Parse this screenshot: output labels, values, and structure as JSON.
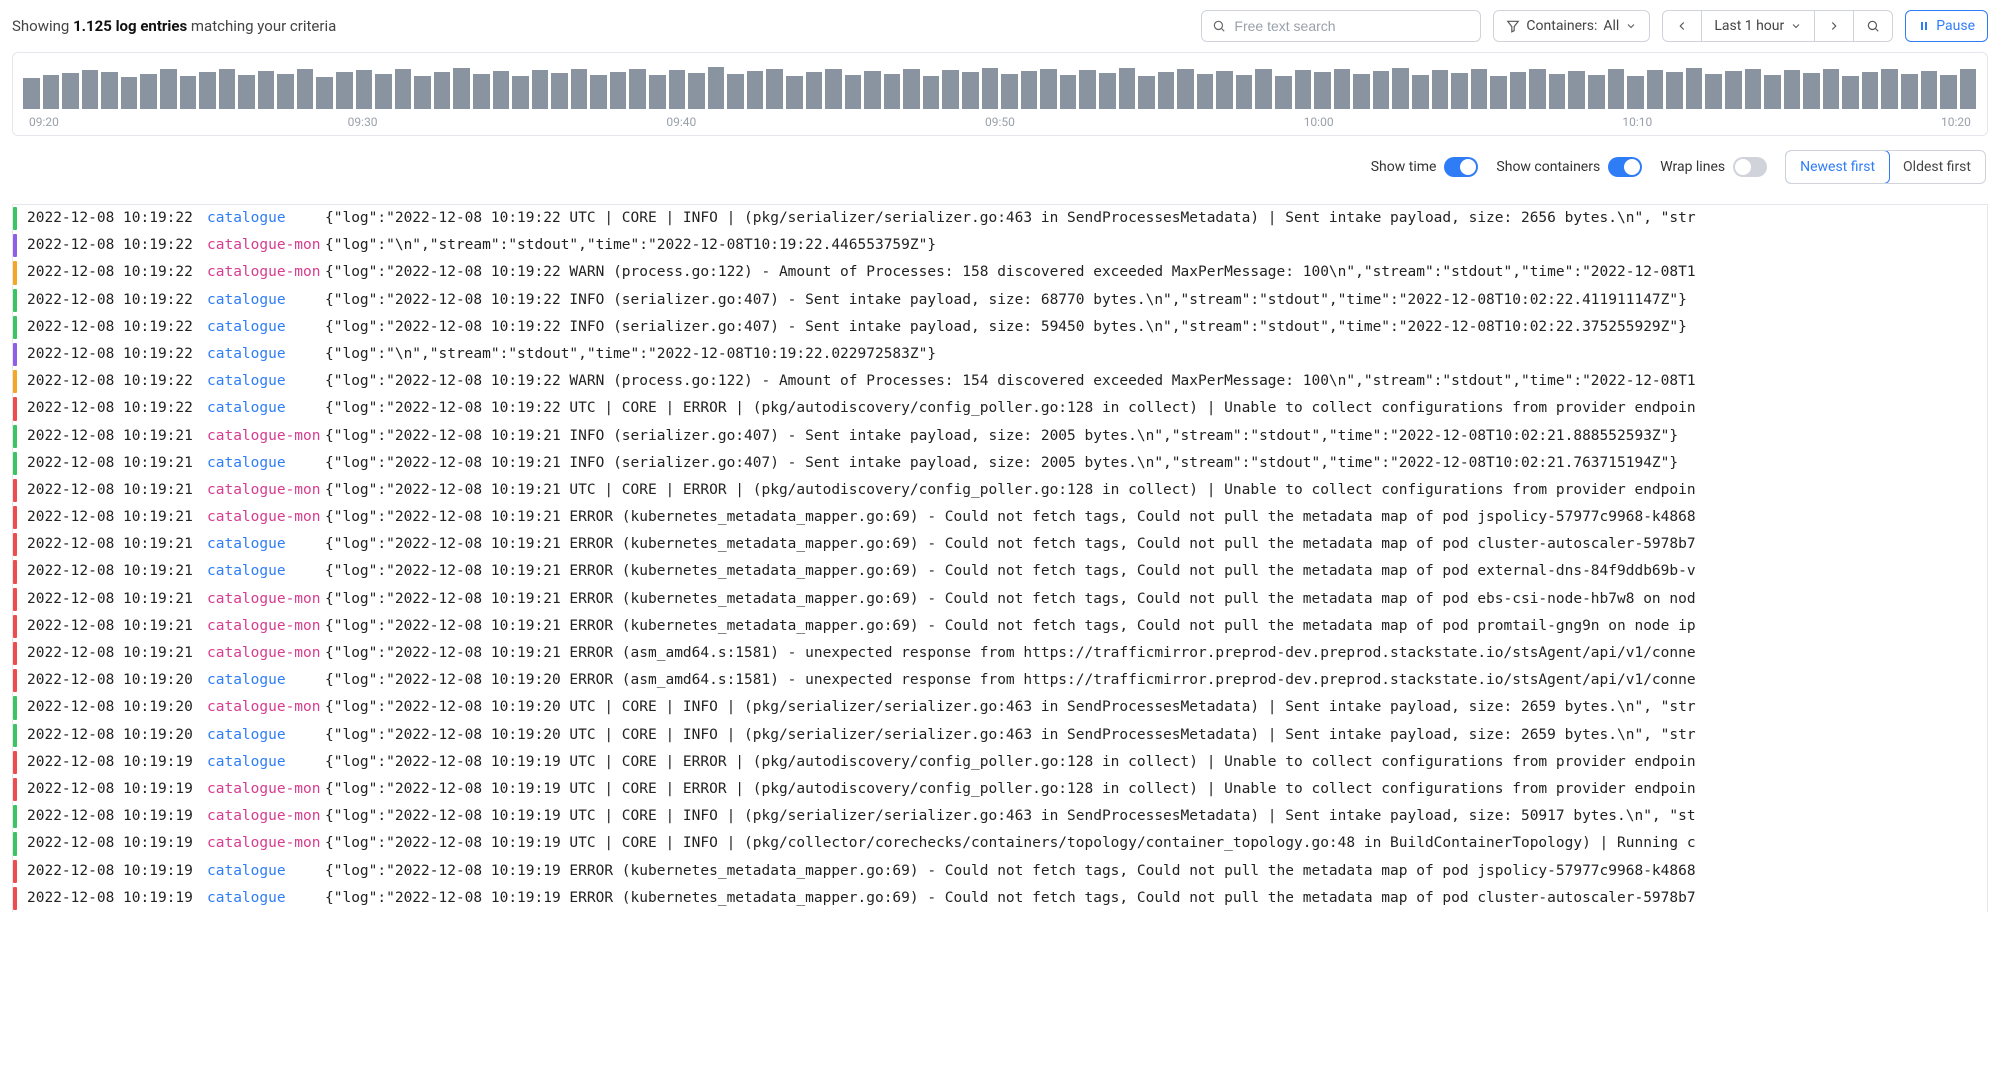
{
  "header": {
    "showing_prefix": "Showing ",
    "count": "1.125 log entries",
    "showing_suffix": " matching your criteria",
    "search_placeholder": "Free text search",
    "containers_label": "Containers:",
    "containers_value": "All",
    "time_range": "Last 1 hour",
    "pause_label": "Pause"
  },
  "axis": {
    "t0": "09:20",
    "t1": "09:30",
    "t2": "09:40",
    "t3": "09:50",
    "t4": "10:00",
    "t5": "10:10",
    "t6": "10:20"
  },
  "controls": {
    "show_time": "Show time",
    "show_containers": "Show containers",
    "wrap_lines": "Wrap lines",
    "newest_first": "Newest first",
    "oldest_first": "Oldest first"
  },
  "logs": [
    {
      "sev": "green",
      "ts": "2022-12-08 10:19:22",
      "container": "catalogue",
      "cclass": "catalogue",
      "msg": "{\"log\":\"2022-12-08 10:19:22 UTC | CORE | INFO | (pkg/serializer/serializer.go:463 in SendProcessesMetadata) | Sent intake payload, size: 2656 bytes.\\n\", \"str"
    },
    {
      "sev": "purple",
      "ts": "2022-12-08 10:19:22",
      "container": "catalogue-mon",
      "cclass": "mon",
      "msg": "{\"log\":\"\\n\",\"stream\":\"stdout\",\"time\":\"2022-12-08T10:19:22.446553759Z\"}"
    },
    {
      "sev": "orange",
      "ts": "2022-12-08 10:19:22",
      "container": "catalogue-mon",
      "cclass": "mon",
      "msg": "{\"log\":\"2022-12-08 10:19:22 WARN (process.go:122) - Amount of Processes: 158 discovered exceeded MaxPerMessage: 100\\n\",\"stream\":\"stdout\",\"time\":\"2022-12-08T1"
    },
    {
      "sev": "green",
      "ts": "2022-12-08 10:19:22",
      "container": "catalogue",
      "cclass": "catalogue",
      "msg": "{\"log\":\"2022-12-08 10:19:22 INFO (serializer.go:407) - Sent intake payload, size: 68770 bytes.\\n\",\"stream\":\"stdout\",\"time\":\"2022-12-08T10:02:22.411911147Z\"}"
    },
    {
      "sev": "green",
      "ts": "2022-12-08 10:19:22",
      "container": "catalogue",
      "cclass": "catalogue",
      "msg": "{\"log\":\"2022-12-08 10:19:22 INFO (serializer.go:407) - Sent intake payload, size: 59450 bytes.\\n\",\"stream\":\"stdout\",\"time\":\"2022-12-08T10:02:22.375255929Z\"}"
    },
    {
      "sev": "purple",
      "ts": "2022-12-08 10:19:22",
      "container": "catalogue",
      "cclass": "catalogue",
      "msg": "{\"log\":\"\\n\",\"stream\":\"stdout\",\"time\":\"2022-12-08T10:19:22.022972583Z\"}"
    },
    {
      "sev": "orange",
      "ts": "2022-12-08 10:19:22",
      "container": "catalogue",
      "cclass": "catalogue",
      "msg": "{\"log\":\"2022-12-08 10:19:22 WARN (process.go:122) - Amount of Processes: 154 discovered exceeded MaxPerMessage: 100\\n\",\"stream\":\"stdout\",\"time\":\"2022-12-08T1"
    },
    {
      "sev": "red",
      "ts": "2022-12-08 10:19:22",
      "container": "catalogue",
      "cclass": "catalogue",
      "msg": "{\"log\":\"2022-12-08 10:19:22 UTC | CORE | ERROR | (pkg/autodiscovery/config_poller.go:128 in collect) | Unable to collect configurations from provider endpoin"
    },
    {
      "sev": "green",
      "ts": "2022-12-08 10:19:21",
      "container": "catalogue-mon",
      "cclass": "mon",
      "msg": "{\"log\":\"2022-12-08 10:19:21 INFO (serializer.go:407) - Sent intake payload, size: 2005 bytes.\\n\",\"stream\":\"stdout\",\"time\":\"2022-12-08T10:02:21.888552593Z\"}"
    },
    {
      "sev": "green",
      "ts": "2022-12-08 10:19:21",
      "container": "catalogue",
      "cclass": "catalogue",
      "msg": "{\"log\":\"2022-12-08 10:19:21 INFO (serializer.go:407) - Sent intake payload, size: 2005 bytes.\\n\",\"stream\":\"stdout\",\"time\":\"2022-12-08T10:02:21.763715194Z\"}"
    },
    {
      "sev": "red",
      "ts": "2022-12-08 10:19:21",
      "container": "catalogue-mon",
      "cclass": "mon",
      "msg": "{\"log\":\"2022-12-08 10:19:21 UTC | CORE | ERROR | (pkg/autodiscovery/config_poller.go:128 in collect) | Unable to collect configurations from provider endpoin"
    },
    {
      "sev": "red",
      "ts": "2022-12-08 10:19:21",
      "container": "catalogue-mon",
      "cclass": "mon",
      "msg": "{\"log\":\"2022-12-08 10:19:21 ERROR (kubernetes_metadata_mapper.go:69) - Could not fetch tags, Could not pull the metadata map of pod jspolicy-57977c9968-k4868"
    },
    {
      "sev": "red",
      "ts": "2022-12-08 10:19:21",
      "container": "catalogue",
      "cclass": "catalogue",
      "msg": "{\"log\":\"2022-12-08 10:19:21 ERROR (kubernetes_metadata_mapper.go:69) - Could not fetch tags, Could not pull the metadata map of pod cluster-autoscaler-5978b7"
    },
    {
      "sev": "red",
      "ts": "2022-12-08 10:19:21",
      "container": "catalogue",
      "cclass": "catalogue",
      "msg": "{\"log\":\"2022-12-08 10:19:21 ERROR (kubernetes_metadata_mapper.go:69) - Could not fetch tags, Could not pull the metadata map of pod external-dns-84f9ddb69b-v"
    },
    {
      "sev": "red",
      "ts": "2022-12-08 10:19:21",
      "container": "catalogue-mon",
      "cclass": "mon",
      "msg": "{\"log\":\"2022-12-08 10:19:21 ERROR (kubernetes_metadata_mapper.go:69) - Could not fetch tags, Could not pull the metadata map of pod ebs-csi-node-hb7w8 on nod"
    },
    {
      "sev": "red",
      "ts": "2022-12-08 10:19:21",
      "container": "catalogue-mon",
      "cclass": "mon",
      "msg": "{\"log\":\"2022-12-08 10:19:21 ERROR (kubernetes_metadata_mapper.go:69) - Could not fetch tags, Could not pull the metadata map of pod promtail-gng9n on node ip"
    },
    {
      "sev": "red",
      "ts": "2022-12-08 10:19:21",
      "container": "catalogue-mon",
      "cclass": "mon",
      "msg": "{\"log\":\"2022-12-08 10:19:21 ERROR (asm_amd64.s:1581) - unexpected response from https://trafficmirror.preprod-dev.preprod.stackstate.io/stsAgent/api/v1/conne"
    },
    {
      "sev": "red",
      "ts": "2022-12-08 10:19:20",
      "container": "catalogue",
      "cclass": "catalogue",
      "msg": "{\"log\":\"2022-12-08 10:19:20 ERROR (asm_amd64.s:1581) - unexpected response from https://trafficmirror.preprod-dev.preprod.stackstate.io/stsAgent/api/v1/conne"
    },
    {
      "sev": "green",
      "ts": "2022-12-08 10:19:20",
      "container": "catalogue-mon",
      "cclass": "mon",
      "msg": "{\"log\":\"2022-12-08 10:19:20 UTC | CORE | INFO | (pkg/serializer/serializer.go:463 in SendProcessesMetadata) | Sent intake payload, size: 2659 bytes.\\n\", \"str"
    },
    {
      "sev": "green",
      "ts": "2022-12-08 10:19:20",
      "container": "catalogue",
      "cclass": "catalogue",
      "msg": "{\"log\":\"2022-12-08 10:19:20 UTC | CORE | INFO | (pkg/serializer/serializer.go:463 in SendProcessesMetadata) | Sent intake payload, size: 2659 bytes.\\n\", \"str"
    },
    {
      "sev": "red",
      "ts": "2022-12-08 10:19:19",
      "container": "catalogue",
      "cclass": "catalogue",
      "msg": "{\"log\":\"2022-12-08 10:19:19 UTC | CORE | ERROR | (pkg/autodiscovery/config_poller.go:128 in collect) | Unable to collect configurations from provider endpoin"
    },
    {
      "sev": "red",
      "ts": "2022-12-08 10:19:19",
      "container": "catalogue-mon",
      "cclass": "mon",
      "msg": "{\"log\":\"2022-12-08 10:19:19 UTC | CORE | ERROR | (pkg/autodiscovery/config_poller.go:128 in collect) | Unable to collect configurations from provider endpoin"
    },
    {
      "sev": "green",
      "ts": "2022-12-08 10:19:19",
      "container": "catalogue-mon",
      "cclass": "mon",
      "msg": "{\"log\":\"2022-12-08 10:19:19 UTC | CORE | INFO | (pkg/serializer/serializer.go:463 in SendProcessesMetadata) | Sent intake payload, size: 50917 bytes.\\n\", \"st"
    },
    {
      "sev": "green",
      "ts": "2022-12-08 10:19:19",
      "container": "catalogue-mon",
      "cclass": "mon",
      "msg": "{\"log\":\"2022-12-08 10:19:19 UTC | CORE | INFO | (pkg/collector/corechecks/containers/topology/container_topology.go:48 in BuildContainerTopology) | Running c"
    },
    {
      "sev": "red",
      "ts": "2022-12-08 10:19:19",
      "container": "catalogue",
      "cclass": "catalogue",
      "msg": "{\"log\":\"2022-12-08 10:19:19 ERROR (kubernetes_metadata_mapper.go:69) - Could not fetch tags, Could not pull the metadata map of pod jspolicy-57977c9968-k4868"
    },
    {
      "sev": "red",
      "ts": "2022-12-08 10:19:19",
      "container": "catalogue",
      "cclass": "catalogue",
      "msg": "{\"log\":\"2022-12-08 10:19:19 ERROR (kubernetes_metadata_mapper.go:69) - Could not fetch tags, Could not pull the metadata map of pod cluster-autoscaler-5978b7"
    }
  ],
  "chart_data": {
    "type": "bar",
    "title": "",
    "xlabel": "time",
    "ylabel": "",
    "x_range": [
      "09:20",
      "10:20"
    ],
    "note": "heights estimated relative to max=1.0; ~100 buckets",
    "values": [
      0.7,
      0.78,
      0.82,
      0.88,
      0.85,
      0.72,
      0.8,
      0.9,
      0.75,
      0.83,
      0.92,
      0.78,
      0.86,
      0.8,
      0.9,
      0.73,
      0.84,
      0.88,
      0.79,
      0.91,
      0.76,
      0.85,
      0.93,
      0.8,
      0.87,
      0.74,
      0.89,
      0.81,
      0.92,
      0.78,
      0.85,
      0.9,
      0.77,
      0.88,
      0.82,
      0.95,
      0.79,
      0.86,
      0.9,
      0.75,
      0.83,
      0.91,
      0.78,
      0.87,
      0.8,
      0.92,
      0.74,
      0.88,
      0.85,
      0.93,
      0.79,
      0.86,
      0.9,
      0.77,
      0.88,
      0.82,
      0.94,
      0.76,
      0.85,
      0.91,
      0.8,
      0.87,
      0.78,
      0.92,
      0.74,
      0.88,
      0.85,
      0.9,
      0.79,
      0.86,
      0.93,
      0.77,
      0.88,
      0.82,
      0.91,
      0.76,
      0.85,
      0.9,
      0.8,
      0.87,
      0.78,
      0.92,
      0.74,
      0.88,
      0.85,
      0.93,
      0.79,
      0.86,
      0.9,
      0.77,
      0.88,
      0.82,
      0.91,
      0.76,
      0.85,
      0.9,
      0.8,
      0.87,
      0.78,
      0.92
    ]
  }
}
